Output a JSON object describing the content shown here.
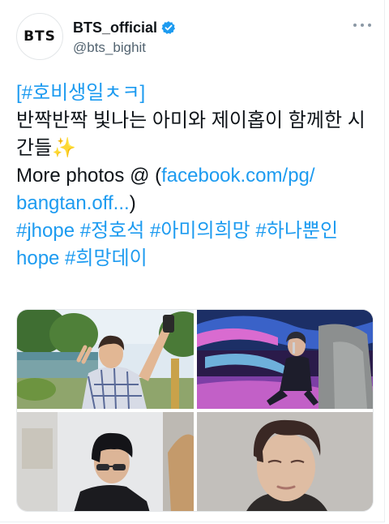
{
  "account": {
    "display_name": "BTS_official",
    "handle": "@bts_bighit",
    "avatar_text": "BTS",
    "verified": true
  },
  "tweet": {
    "lines": [
      {
        "parts": [
          {
            "text": "[#호비생일ㅊㅋ]",
            "link": true
          }
        ]
      },
      {
        "parts": [
          {
            "text": "반짝반짝 빛나는 아미와 제이홉이 함께한 시",
            "link": false
          }
        ]
      },
      {
        "parts": [
          {
            "text": "간들✨",
            "link": false
          }
        ]
      },
      {
        "parts": [
          {
            "text": "More photos @ (",
            "link": false
          },
          {
            "text": "facebook.com/pg/",
            "link": true
          }
        ]
      },
      {
        "parts": [
          {
            "text": "bangtan.off...",
            "link": true
          },
          {
            "text": ")",
            "link": false
          }
        ]
      },
      {
        "parts": [
          {
            "text": "#jhope #정호석 #아미의희망 #하나뿐인",
            "link": true
          }
        ]
      },
      {
        "parts": [
          {
            "text": "hope #희망데이",
            "link": true
          }
        ]
      }
    ]
  },
  "media": {
    "photos": [
      "photo-selfie-outdoor",
      "photo-stage-performance",
      "photo-backstage-sunglasses",
      "photo-portrait-closeup"
    ]
  },
  "colors": {
    "link": "#1d9bf0",
    "verified_badge": "#1d9bf0",
    "text": "#0f1419",
    "secondary": "#536471"
  }
}
